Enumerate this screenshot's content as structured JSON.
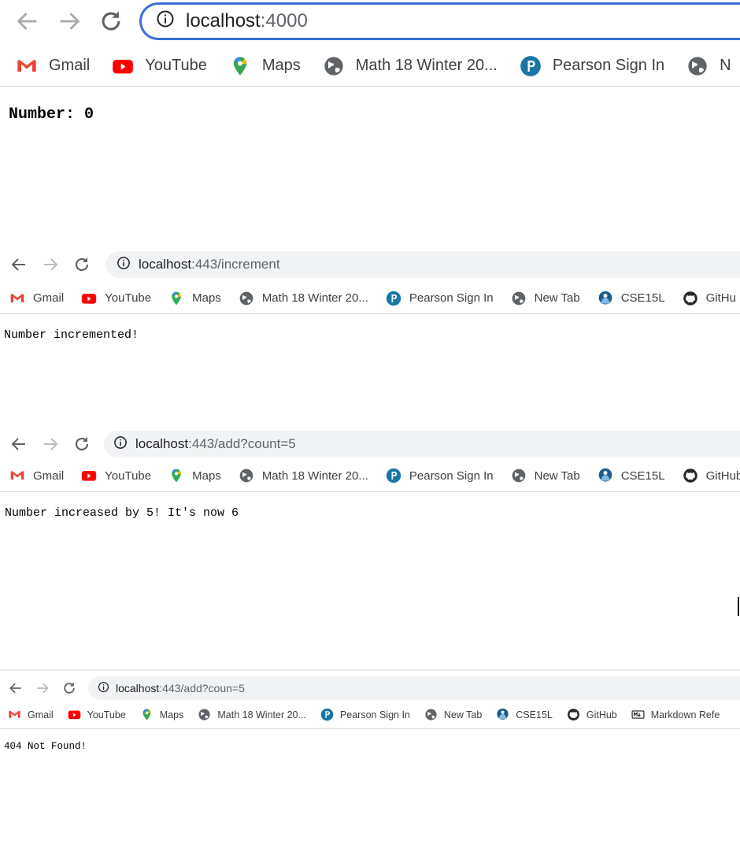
{
  "windows": [
    {
      "url": {
        "host": "localhost",
        "path": ":4000"
      },
      "bookmarks": [
        {
          "label": "Gmail",
          "icon": "gmail-icon"
        },
        {
          "label": "YouTube",
          "icon": "youtube-icon"
        },
        {
          "label": "Maps",
          "icon": "maps-icon"
        },
        {
          "label": "Math 18 Winter 20...",
          "icon": "globe-icon"
        },
        {
          "label": "Pearson Sign In",
          "icon": "pearson-icon"
        },
        {
          "label": "N",
          "icon": "globe-icon"
        }
      ],
      "page_text": "Number: 0"
    },
    {
      "url": {
        "host": "localhost",
        "path": ":443/increment"
      },
      "bookmarks": [
        {
          "label": "Gmail",
          "icon": "gmail-icon"
        },
        {
          "label": "YouTube",
          "icon": "youtube-icon"
        },
        {
          "label": "Maps",
          "icon": "maps-icon"
        },
        {
          "label": "Math 18 Winter 20...",
          "icon": "globe-icon"
        },
        {
          "label": "Pearson Sign In",
          "icon": "pearson-icon"
        },
        {
          "label": "New Tab",
          "icon": "globe-icon"
        },
        {
          "label": "CSE15L",
          "icon": "cse15l-icon"
        },
        {
          "label": "GitHu",
          "icon": "github-icon"
        }
      ],
      "page_text": "Number incremented!"
    },
    {
      "url": {
        "host": "localhost",
        "path": ":443/add?count=5"
      },
      "bookmarks": [
        {
          "label": "Gmail",
          "icon": "gmail-icon"
        },
        {
          "label": "YouTube",
          "icon": "youtube-icon"
        },
        {
          "label": "Maps",
          "icon": "maps-icon"
        },
        {
          "label": "Math 18 Winter 20...",
          "icon": "globe-icon"
        },
        {
          "label": "Pearson Sign In",
          "icon": "pearson-icon"
        },
        {
          "label": "New Tab",
          "icon": "globe-icon"
        },
        {
          "label": "CSE15L",
          "icon": "cse15l-icon"
        },
        {
          "label": "GitHub",
          "icon": "github-icon"
        }
      ],
      "page_text": "Number increased by 5! It's now 6"
    },
    {
      "url": {
        "host": "localhost",
        "path": ":443/add?coun=5"
      },
      "bookmarks": [
        {
          "label": "Gmail",
          "icon": "gmail-icon"
        },
        {
          "label": "YouTube",
          "icon": "youtube-icon"
        },
        {
          "label": "Maps",
          "icon": "maps-icon"
        },
        {
          "label": "Math 18 Winter 20...",
          "icon": "globe-icon"
        },
        {
          "label": "Pearson Sign In",
          "icon": "pearson-icon"
        },
        {
          "label": "New Tab",
          "icon": "globe-icon"
        },
        {
          "label": "CSE15L",
          "icon": "cse15l-icon"
        },
        {
          "label": "GitHub",
          "icon": "github-icon"
        },
        {
          "label": "Markdown Refe",
          "icon": "markdown-icon"
        }
      ],
      "page_text": "404 Not Found!"
    }
  ],
  "colors": {
    "focus_ring": "#3b6fd8",
    "omnibox_bg": "#f1f3f4",
    "youtube_red": "#ff0000",
    "pearson_blue": "#1b76a8"
  }
}
